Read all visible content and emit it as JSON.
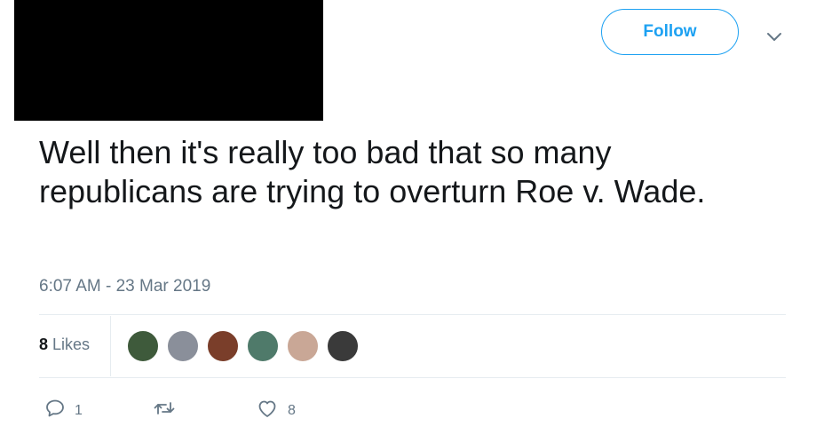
{
  "header": {
    "follow_label": "Follow"
  },
  "tweet": {
    "text": "Well then it's really too bad that so many republicans are trying to overturn Roe v. Wade.",
    "timestamp": "6:07 AM - 23 Mar 2019"
  },
  "stats": {
    "likes_count": "8",
    "likes_label": "Likes",
    "avatar_colors": [
      "#3e5a3b",
      "#8a8f9a",
      "#7a3e2a",
      "#4f7a6a",
      "#c9a796",
      "#3a3a3a"
    ]
  },
  "actions": {
    "reply_count": "1",
    "retweet_count": "",
    "like_count": "8"
  },
  "colors": {
    "accent": "#1da1f2",
    "muted": "#657786",
    "text": "#14171a",
    "divider": "#e6ecf0"
  }
}
